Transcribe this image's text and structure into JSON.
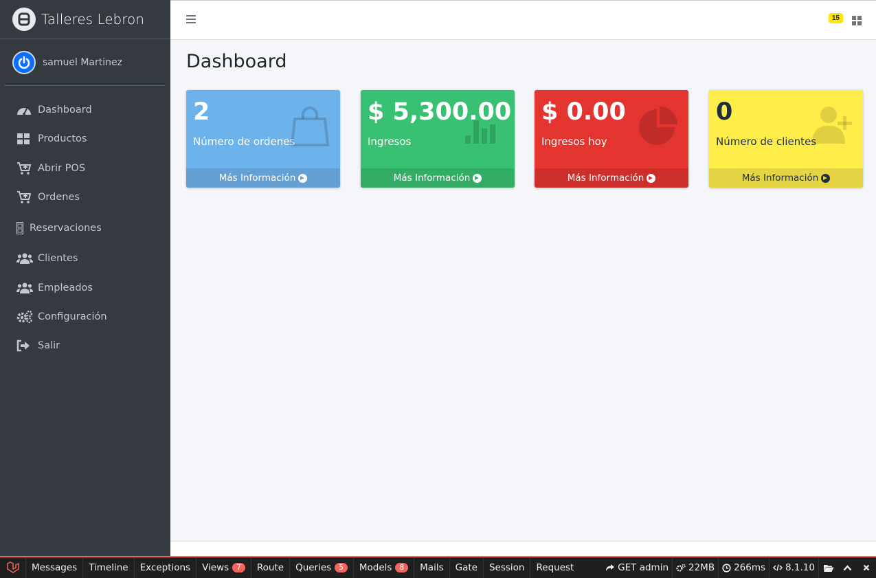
{
  "brand": {
    "name": "Talleres Lebron"
  },
  "user": {
    "name": "samuel Martinez"
  },
  "sidebar": {
    "items": [
      {
        "label": "Dashboard",
        "icon": "tachometer-icon"
      },
      {
        "label": "Productos",
        "icon": "th-large-icon"
      },
      {
        "label": "Abrir POS",
        "icon": "cart-plus-icon"
      },
      {
        "label": "Ordenes",
        "icon": "cart-plus-icon"
      },
      {
        "label": "Reservaciones",
        "icon": "calendar-broken-icon"
      },
      {
        "label": "Clientes",
        "icon": "users-icon"
      },
      {
        "label": "Empleados",
        "icon": "users-icon"
      },
      {
        "label": "Configuración",
        "icon": "cogs-icon"
      },
      {
        "label": "Salir",
        "icon": "sign-out-icon"
      }
    ]
  },
  "topbar": {
    "notification_count": "15"
  },
  "page": {
    "title": "Dashboard"
  },
  "cards": [
    {
      "value": "2",
      "label": "Número de ordenes",
      "link": "Más Información",
      "icon": "shopping-bag-icon",
      "color": "#6cb2eb"
    },
    {
      "value": "$ 5,300.00",
      "label": "Ingresos",
      "link": "Más Información",
      "icon": "bar-chart-icon",
      "color": "#38c172"
    },
    {
      "value": "$ 0.00",
      "label": "Ingresos hoy",
      "link": "Más Información",
      "icon": "pie-chart-icon",
      "color": "#e3342f"
    },
    {
      "value": "0",
      "label": "Número de clientes",
      "link": "Más Información",
      "icon": "user-plus-icon",
      "color": "#ffed4a"
    }
  ],
  "debugbar": {
    "tabs": [
      {
        "label": "Messages"
      },
      {
        "label": "Timeline"
      },
      {
        "label": "Exceptions"
      },
      {
        "label": "Views",
        "badge": "7"
      },
      {
        "label": "Route"
      },
      {
        "label": "Queries",
        "badge": "5"
      },
      {
        "label": "Models",
        "badge": "8"
      },
      {
        "label": "Mails"
      },
      {
        "label": "Gate"
      },
      {
        "label": "Session"
      },
      {
        "label": "Request"
      }
    ],
    "request": "GET admin",
    "memory": "22MB",
    "time": "266ms",
    "version": "8.1.10"
  }
}
